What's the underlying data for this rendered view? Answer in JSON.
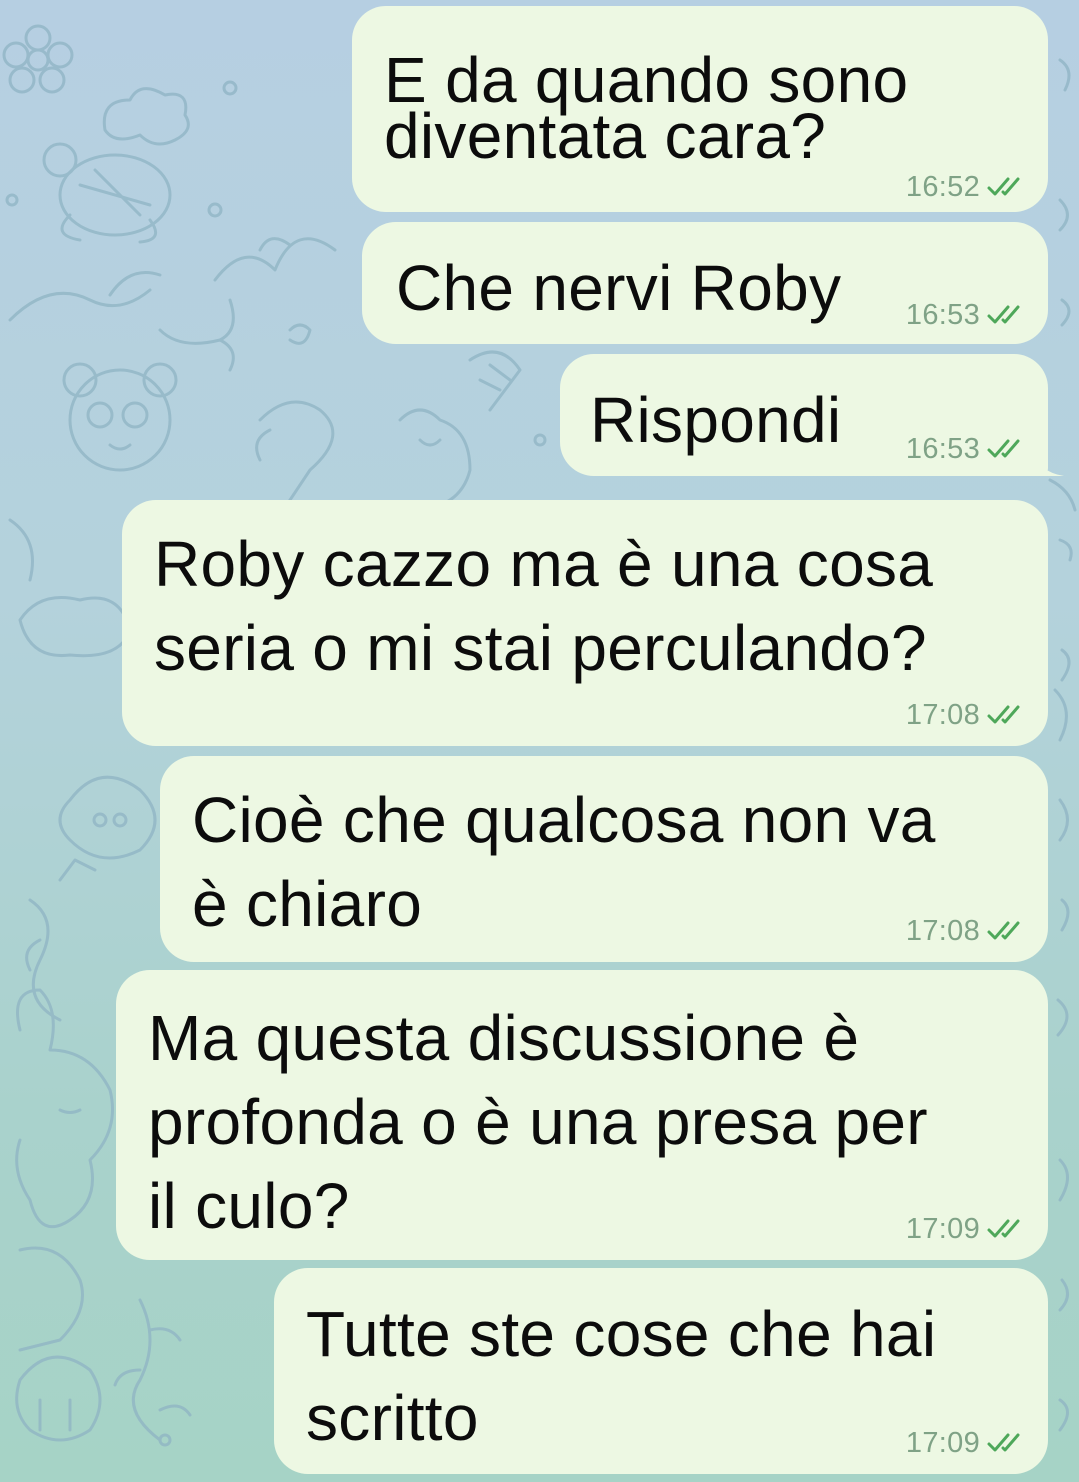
{
  "chat": {
    "messages": [
      {
        "text_lines": [
          "E da quando sono",
          "diventata cara?"
        ],
        "time": "16:52",
        "status": "read-double-check-icon"
      },
      {
        "text_lines": [
          "Che nervi Roby"
        ],
        "time": "16:53",
        "status": "read-double-check-icon"
      },
      {
        "text_lines": [
          "Rispondi"
        ],
        "time": "16:53",
        "status": "read-double-check-icon"
      },
      {
        "text_lines": [
          "Roby cazzo ma è una cosa",
          "seria o mi stai perculando?"
        ],
        "time": "17:08",
        "status": "read-double-check-icon"
      },
      {
        "text_lines": [
          "Cioè che qualcosa non va",
          "è chiaro"
        ],
        "time": "17:08",
        "status": "read-double-check-icon"
      },
      {
        "text_lines": [
          "Ma questa discussione è",
          "profonda o è una presa per",
          "il culo?"
        ],
        "time": "17:09",
        "status": "read-double-check-icon"
      },
      {
        "text_lines": [
          "Tutte ste cose che hai",
          "scritto"
        ],
        "time": "17:09",
        "status": "read-double-check-icon"
      }
    ]
  },
  "colors": {
    "bubble": "#edf8e3",
    "time": "#7fa286",
    "ticks": "#4ea85a",
    "background_top": "#b6cfe2",
    "background_bottom": "#a6d3c6"
  }
}
